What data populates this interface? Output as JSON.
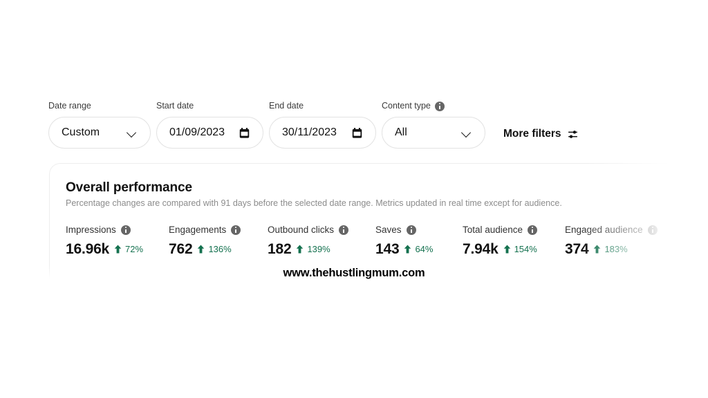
{
  "filters": {
    "date_range": {
      "label": "Date range",
      "value": "Custom",
      "icon": "chevron-down-icon"
    },
    "start_date": {
      "label": "Start date",
      "value": "01/09/2023",
      "icon": "calendar-icon"
    },
    "end_date": {
      "label": "End date",
      "value": "30/11/2023",
      "icon": "calendar-icon"
    },
    "content_type": {
      "label": "Content type",
      "value": "All",
      "icon": "chevron-down-icon",
      "info_icon": "info-icon"
    },
    "more_filters": {
      "label": "More filters",
      "icon": "tune-icon"
    }
  },
  "card": {
    "title": "Overall performance",
    "subtitle": "Percentage changes are compared with 91 days before the selected date range. Metrics updated in real time except for audience.",
    "metrics": [
      {
        "label": "Impressions",
        "value": "16.96k",
        "delta": "72%",
        "direction": "up",
        "info_icon": "info-icon",
        "arrow_icon": "arrow-up-icon"
      },
      {
        "label": "Engagements",
        "value": "762",
        "delta": "136%",
        "direction": "up",
        "info_icon": "info-icon",
        "arrow_icon": "arrow-up-icon"
      },
      {
        "label": "Outbound clicks",
        "value": "182",
        "delta": "139%",
        "direction": "up",
        "info_icon": "info-icon",
        "arrow_icon": "arrow-up-icon"
      },
      {
        "label": "Saves",
        "value": "143",
        "delta": "64%",
        "direction": "up",
        "info_icon": "info-icon",
        "arrow_icon": "arrow-up-icon"
      },
      {
        "label": "Total audience",
        "value": "7.94k",
        "delta": "154%",
        "direction": "up",
        "info_icon": "info-icon",
        "arrow_icon": "arrow-up-icon"
      },
      {
        "label": "Engaged audience",
        "value": "374",
        "delta": "183%",
        "direction": "up",
        "info_icon": "info-icon",
        "arrow_icon": "arrow-up-icon"
      }
    ]
  },
  "watermark": {
    "text": "www.thehustlingmum.com"
  },
  "colors": {
    "positive_delta": "#14714f",
    "text_primary": "#111111",
    "text_muted": "#8c8c8c",
    "border": "#e3e3e3",
    "background": "#ffffff"
  }
}
